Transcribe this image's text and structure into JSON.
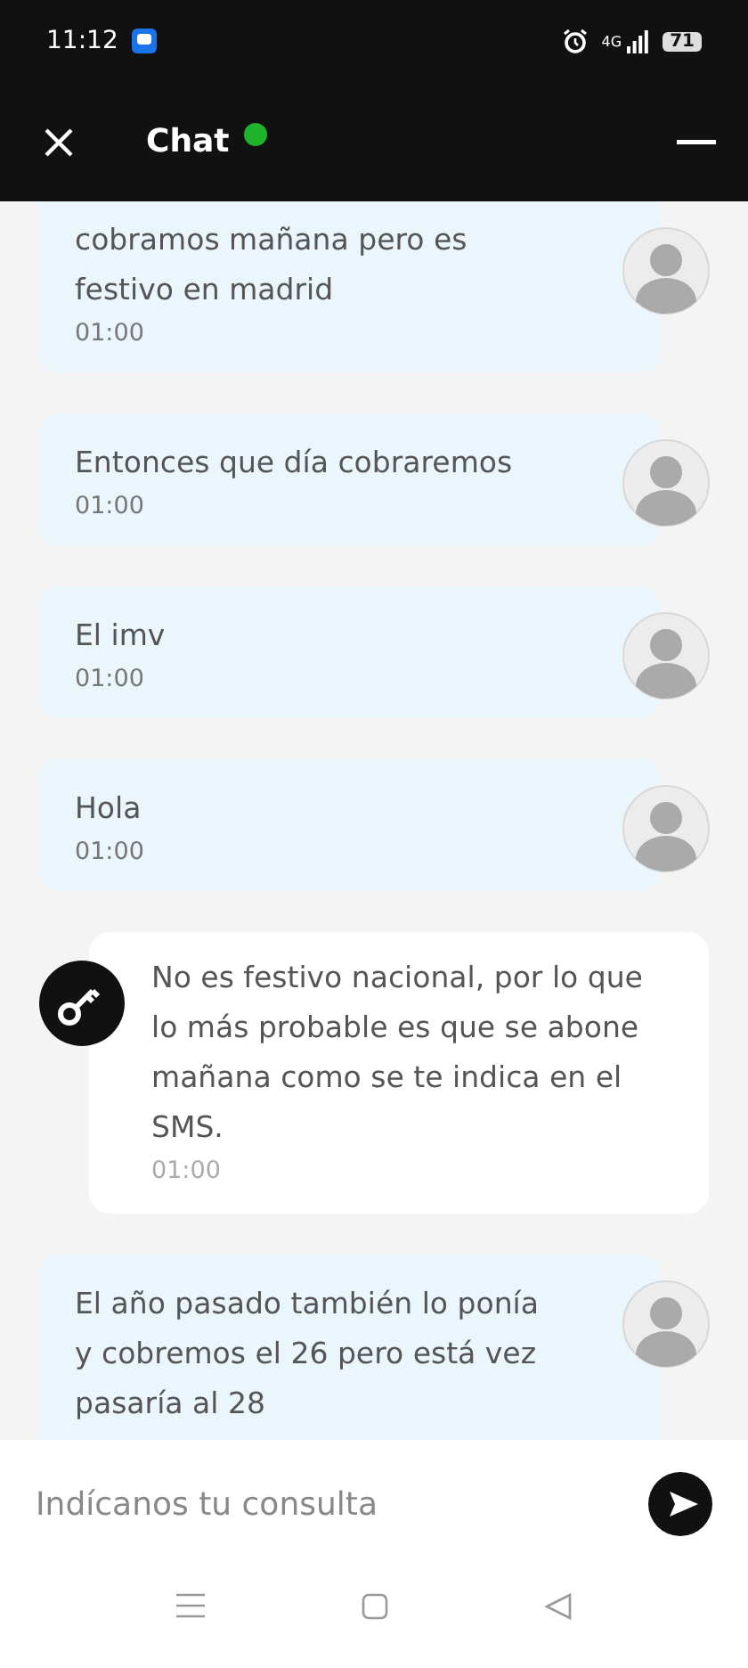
{
  "status_bar": {
    "time": "11:12",
    "network": "4G",
    "battery": "71"
  },
  "header": {
    "title": "Chat",
    "online": true
  },
  "messages": [
    {
      "kind": "user",
      "text": "cobramos mañana pero es festivo en madrid",
      "time": "01:00",
      "cut_top": true
    },
    {
      "kind": "user",
      "text": "Entonces que día cobraremos",
      "time": "01:00"
    },
    {
      "kind": "user",
      "text": "El imv",
      "time": "01:00"
    },
    {
      "kind": "user",
      "text": "Hola",
      "time": "01:00"
    },
    {
      "kind": "agent",
      "text": "No es festivo nacional, por lo que lo más probable es que se abone mañana como se te indica en el SMS.",
      "time": "01:00"
    },
    {
      "kind": "user",
      "text": "El año pasado también lo ponía y cobremos el 26 pero está vez pasaría al 28"
    }
  ],
  "composer": {
    "placeholder": "Indícanos tu consulta"
  }
}
